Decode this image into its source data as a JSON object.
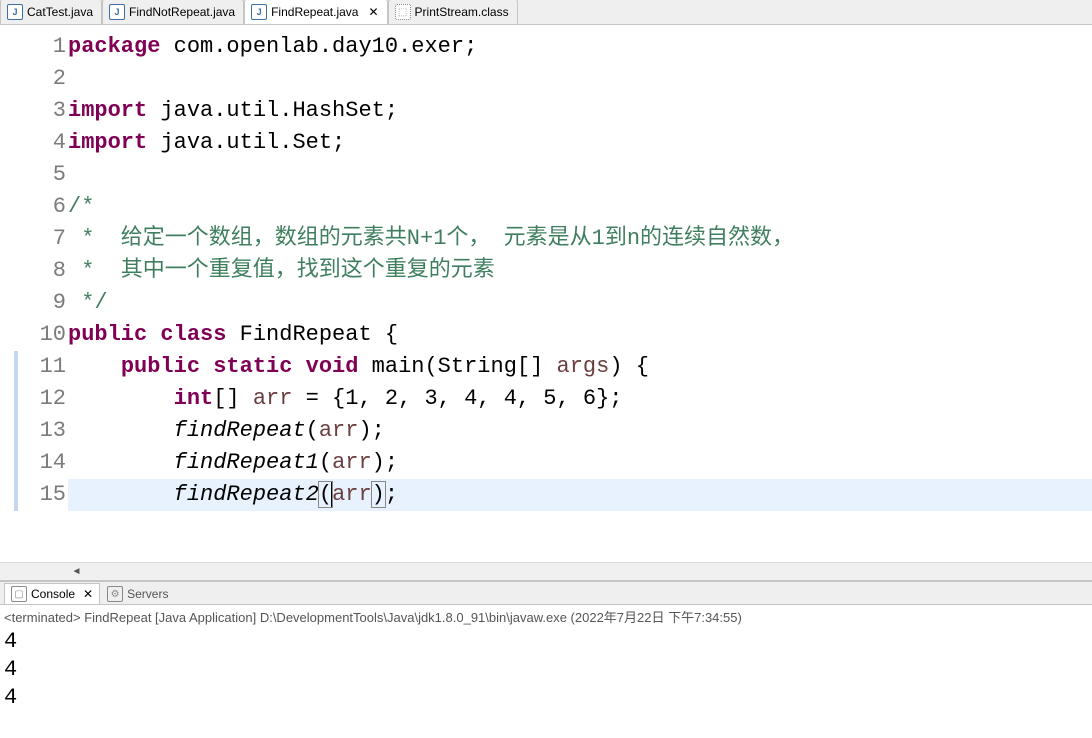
{
  "tabs": [
    {
      "label": "CatTest.java",
      "type": "java",
      "active": false
    },
    {
      "label": "FindNotRepeat.java",
      "type": "java",
      "active": false
    },
    {
      "label": "FindRepeat.java",
      "type": "java",
      "active": true
    },
    {
      "label": "PrintStream.class",
      "type": "class",
      "active": false
    }
  ],
  "code": {
    "lines": [
      {
        "n": "1",
        "segs": [
          {
            "t": "package",
            "c": "kw"
          },
          {
            "t": " com.openlab.day10.exer;"
          }
        ]
      },
      {
        "n": "2",
        "segs": []
      },
      {
        "n": "3",
        "segs": [
          {
            "t": "import",
            "c": "kw"
          },
          {
            "t": " java.util.HashSet;"
          }
        ]
      },
      {
        "n": "4",
        "segs": [
          {
            "t": "import",
            "c": "kw"
          },
          {
            "t": " java.util.Set;"
          }
        ]
      },
      {
        "n": "5",
        "segs": []
      },
      {
        "n": "6",
        "segs": [
          {
            "t": "/*",
            "c": "cm"
          }
        ]
      },
      {
        "n": "7",
        "segs": [
          {
            "t": " *  给定一个数组，数组的元素共N+1个， 元素是从1到n的连续自然数，",
            "c": "cm"
          }
        ]
      },
      {
        "n": "8",
        "segs": [
          {
            "t": " *  其中一个重复值，找到这个重复的元素",
            "c": "cm"
          }
        ]
      },
      {
        "n": "9",
        "segs": [
          {
            "t": " */",
            "c": "cm"
          }
        ]
      },
      {
        "n": "10",
        "segs": [
          {
            "t": "public",
            "c": "kw"
          },
          {
            "t": " "
          },
          {
            "t": "class",
            "c": "kw"
          },
          {
            "t": " FindRepeat {"
          }
        ]
      },
      {
        "n": "11",
        "segs": [
          {
            "t": "    "
          },
          {
            "t": "public",
            "c": "kw"
          },
          {
            "t": " "
          },
          {
            "t": "static",
            "c": "kw"
          },
          {
            "t": " "
          },
          {
            "t": "void",
            "c": "kw"
          },
          {
            "t": " main(String[] "
          },
          {
            "t": "args",
            "c": "local"
          },
          {
            "t": ") {"
          }
        ],
        "bar": true
      },
      {
        "n": "12",
        "segs": [
          {
            "t": "        "
          },
          {
            "t": "int",
            "c": "kw"
          },
          {
            "t": "[] "
          },
          {
            "t": "arr",
            "c": "local"
          },
          {
            "t": " = {1, 2, 3, 4, 4, 5, 6};"
          }
        ],
        "bar": true
      },
      {
        "n": "13",
        "segs": [
          {
            "t": "        "
          },
          {
            "t": "findRepeat",
            "c": "italic"
          },
          {
            "t": "("
          },
          {
            "t": "arr",
            "c": "local"
          },
          {
            "t": ");"
          }
        ],
        "bar": true
      },
      {
        "n": "14",
        "segs": [
          {
            "t": "        "
          },
          {
            "t": "findRepeat1",
            "c": "italic"
          },
          {
            "t": "("
          },
          {
            "t": "arr",
            "c": "local"
          },
          {
            "t": ");"
          }
        ],
        "bar": true
      },
      {
        "n": "15",
        "segs": [
          {
            "t": "        "
          },
          {
            "t": "findRepeat2",
            "c": "italic"
          },
          {
            "t": "(",
            "c": "",
            "bm": true
          },
          {
            "t": "",
            "caret": true
          },
          {
            "t": "arr",
            "c": "local"
          },
          {
            "t": ")",
            "c": "",
            "bm": true
          },
          {
            "t": ";"
          }
        ],
        "hl": true,
        "bar": true
      }
    ]
  },
  "console": {
    "tabs": [
      {
        "label": "Console",
        "active": true
      },
      {
        "label": "Servers",
        "active": false
      }
    ],
    "status": "<terminated> FindRepeat [Java Application] D:\\DevelopmentTools\\Java\\jdk1.8.0_91\\bin\\javaw.exe (2022年7月22日 下午7:34:55)",
    "output": [
      "4",
      "4",
      "4"
    ]
  }
}
